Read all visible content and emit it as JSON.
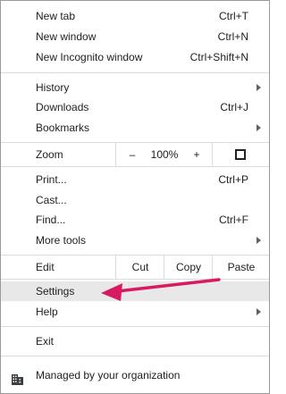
{
  "menu": {
    "new_tab": {
      "label": "New tab",
      "shortcut": "Ctrl+T"
    },
    "new_window": {
      "label": "New window",
      "shortcut": "Ctrl+N"
    },
    "new_incognito": {
      "label": "New Incognito window",
      "shortcut": "Ctrl+Shift+N"
    },
    "history": {
      "label": "History"
    },
    "downloads": {
      "label": "Downloads",
      "shortcut": "Ctrl+J"
    },
    "bookmarks": {
      "label": "Bookmarks"
    },
    "zoom": {
      "label": "Zoom",
      "minus": "–",
      "level": "100%",
      "plus": "+"
    },
    "print": {
      "label": "Print...",
      "shortcut": "Ctrl+P"
    },
    "cast": {
      "label": "Cast..."
    },
    "find": {
      "label": "Find...",
      "shortcut": "Ctrl+F"
    },
    "more_tools": {
      "label": "More tools"
    },
    "edit": {
      "label": "Edit",
      "cut": "Cut",
      "copy": "Copy",
      "paste": "Paste"
    },
    "settings": {
      "label": "Settings",
      "highlighted": true
    },
    "help": {
      "label": "Help"
    },
    "exit": {
      "label": "Exit"
    },
    "managed": {
      "label": "Managed by your organization",
      "icon": "building-icon"
    }
  },
  "colors": {
    "highlight": "#e8e8e8",
    "arrow_annotation": "#d81b60",
    "separator": "#dadce0"
  }
}
